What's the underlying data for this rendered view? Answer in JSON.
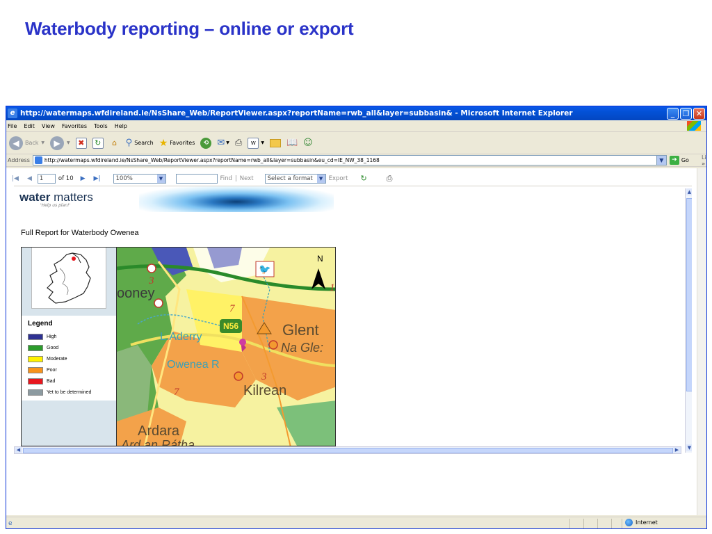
{
  "slide": {
    "title": "Waterbody reporting – online or export"
  },
  "window": {
    "title": "http://watermaps.wfdireland.ie/NsShare_Web/ReportViewer.aspx?reportName=rwb_all&layer=subbasin& - Microsoft Internet Explorer"
  },
  "menu": {
    "items": [
      "File",
      "Edit",
      "View",
      "Favorites",
      "Tools",
      "Help"
    ]
  },
  "toolbar": {
    "back": "Back",
    "search": "Search",
    "favorites": "Favorites"
  },
  "address": {
    "label": "Address",
    "url": "http://watermaps.wfdireland.ie/NsShare_Web/ReportViewer.aspx?reportName=rwb_all&layer=subbasin&eu_cd=IE_NW_38_1168",
    "go": "Go",
    "links": "Links"
  },
  "report_toolbar": {
    "page": "1",
    "of_pages": "of 10",
    "zoom": "100%",
    "find": "Find",
    "separator": "|",
    "next": "Next",
    "format": "Select a format",
    "export": "Export"
  },
  "report": {
    "logo_bold": "water",
    "logo_light": " matters",
    "tagline": "'Help us plan!'",
    "heading": "Full Report for Waterbody Owenea",
    "legend_title": "Legend",
    "legend": [
      {
        "label": "High",
        "color": "#2e3192"
      },
      {
        "label": "Good",
        "color": "#2c9c2c"
      },
      {
        "label": "Moderate",
        "color": "#fff200"
      },
      {
        "label": "Poor",
        "color": "#f7941d"
      },
      {
        "label": "Bad",
        "color": "#e8161e"
      },
      {
        "label": "Yet to be determined",
        "color": "#8c9aa0"
      }
    ],
    "map_labels": {
      "road": "N56",
      "north": "N",
      "town1": "Glent",
      "town1_irish": "Na Gle:",
      "town2": "Kilrean",
      "town3": "Ardara",
      "town3_irish": "Ard an Rátha",
      "lake": "L.Aderry",
      "river": "Owenea R",
      "place": "ooney",
      "num_a": "3",
      "num_b": "7",
      "num_c": "3",
      "num_d": "7",
      "num_e": "1"
    }
  },
  "status": {
    "zone": "Internet"
  }
}
